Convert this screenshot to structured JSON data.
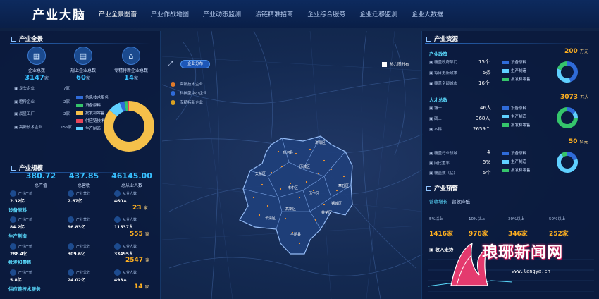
{
  "app": {
    "title": "产业大脑"
  },
  "nav": [
    {
      "label": "产业全景图谱",
      "active": true
    },
    {
      "label": "产业作战地图"
    },
    {
      "label": "产业动态监测"
    },
    {
      "label": "沿链精准招商"
    },
    {
      "label": "企业综合服务"
    },
    {
      "label": "企业迁移监测"
    },
    {
      "label": "企业大数据"
    }
  ],
  "overview": {
    "title": "产业全景",
    "kpis": [
      {
        "label": "企业总数",
        "value": "3147",
        "unit": "家",
        "icon": "building-icon"
      },
      {
        "label": "规上企业总数",
        "value": "60",
        "unit": "家",
        "icon": "document-icon"
      },
      {
        "label": "专精特新企业总数",
        "value": "14",
        "unit": "家",
        "icon": "store-icon"
      }
    ],
    "list": [
      {
        "label": "龙头企业",
        "value": "7家"
      },
      {
        "label": "瞪羚企业",
        "value": "2家"
      },
      {
        "label": "晨星工厂",
        "value": "2家"
      },
      {
        "label": "高新技术企业",
        "value": "156家"
      }
    ],
    "legend": [
      {
        "label": "信息技术服务",
        "color": "#2f6bd8"
      },
      {
        "label": "设备原料",
        "color": "#35c56b"
      },
      {
        "label": "批发和零售",
        "color": "#f5c04a"
      },
      {
        "label": "供应链技术服务",
        "color": "#e8465a"
      },
      {
        "label": "生产制造",
        "color": "#5fd0ff"
      }
    ],
    "donut": [
      {
        "label": "批发和零售",
        "value": 86,
        "color": "#f5c04a"
      },
      {
        "label": "生产制造",
        "value": 8,
        "color": "#5fd0ff"
      },
      {
        "label": "信息技术服务",
        "value": 3,
        "color": "#2f6bd8"
      },
      {
        "label": "设备原料",
        "value": 2,
        "color": "#35c56b"
      },
      {
        "label": "供应链技术服务",
        "value": 1,
        "color": "#e8465a"
      }
    ]
  },
  "scale": {
    "title": "产业规模",
    "big": [
      {
        "value": "380.72",
        "label": "总产值"
      },
      {
        "value": "437.85",
        "label": "总营收"
      },
      {
        "value": "46145.00",
        "label": "总从业人数"
      }
    ],
    "groups": [
      {
        "name": "",
        "total": "",
        "stats": [
          {
            "label": "产业产值",
            "value": "2.32亿"
          },
          {
            "label": "产业营收",
            "value": "2.67亿"
          },
          {
            "label": "从业人数",
            "value": "460人"
          }
        ]
      },
      {
        "name": "设备原料",
        "total": "23",
        "unit": "家",
        "stats": [
          {
            "label": "产业产值",
            "value": "84.2亿"
          },
          {
            "label": "产业营收",
            "value": "96.83亿"
          },
          {
            "label": "从业人数",
            "value": "11537人"
          }
        ]
      },
      {
        "name": "生产制造",
        "total": "555",
        "unit": "家",
        "stats": [
          {
            "label": "产业产值",
            "value": "288.4亿"
          },
          {
            "label": "产业营收",
            "value": "309.6亿"
          },
          {
            "label": "从业人数",
            "value": "33495人"
          }
        ]
      },
      {
        "name": "批发和零售",
        "total": "2547",
        "unit": "家",
        "stats": [
          {
            "label": "产业产值",
            "value": "5.8亿"
          },
          {
            "label": "产业营收",
            "value": "24.02亿"
          },
          {
            "label": "从业人数",
            "value": "493人"
          }
        ]
      },
      {
        "name": "供应链技术服务",
        "total": "14",
        "unit": "家",
        "stats": []
      }
    ]
  },
  "map": {
    "pill": "企业分布",
    "heat_label": "热力图分布",
    "legend": [
      {
        "label": "高新技术企业",
        "color": "#e07a2a"
      },
      {
        "label": "科技型中小企业",
        "color": "#2f6bd8"
      },
      {
        "label": "专精特新企业",
        "color": "#d9a021"
      }
    ],
    "regions": [
      "莱芜区",
      "钢城区",
      "历城区",
      "章丘区",
      "济阳区",
      "商河县",
      "天桥区",
      "槐荫区",
      "市中区",
      "历下区",
      "长清区",
      "平阴县",
      "莱芜区",
      "高新区"
    ]
  },
  "resources": {
    "title": "产业资源",
    "blocks": [
      {
        "name": "产业政策",
        "total": "200",
        "unit": "万元",
        "rows": [
          {
            "label": "覆盖政府部门",
            "value": "15个"
          },
          {
            "label": "每日更新政策",
            "value": "5条"
          },
          {
            "label": "覆盖全部城市",
            "value": "16个"
          }
        ],
        "legend": [
          "设备原料",
          "生产制造",
          "批发和零售"
        ]
      },
      {
        "name": "人才总数",
        "total": "3073",
        "unit": "万人",
        "rows": [
          {
            "label": "博士",
            "value": "46人"
          },
          {
            "label": "硕士",
            "value": "368人"
          },
          {
            "label": "本科",
            "value": "2659个"
          }
        ],
        "legend": [
          "设备原料",
          "生产制造",
          "批发和零售"
        ]
      },
      {
        "name": "",
        "total": "50",
        "unit": "亿元",
        "rows": [
          {
            "label": "覆盖行业领域",
            "value": "4"
          },
          {
            "label": "闲比重率",
            "value": "5%"
          },
          {
            "label": "覆盖数（亿）",
            "value": "5个"
          }
        ],
        "legend": [
          "设备原料",
          "生产制造",
          "批发和零售"
        ]
      }
    ],
    "legend_colors": [
      "#2f6bd8",
      "#5fd0ff",
      "#35c56b"
    ]
  },
  "warning": {
    "title": "产业预警",
    "tabs": [
      "营收增长",
      "营收降低"
    ],
    "buckets": [
      {
        "label": "5%以上",
        "value": "1416家"
      },
      {
        "label": "10%以上",
        "value": "976家"
      },
      {
        "label": "30%以上",
        "value": "346家"
      },
      {
        "label": "50%以上",
        "value": "252家"
      }
    ],
    "trend_title": "收入走势"
  },
  "watermark": {
    "text": "琅琊新闻网",
    "url": "www.langya.cn"
  }
}
